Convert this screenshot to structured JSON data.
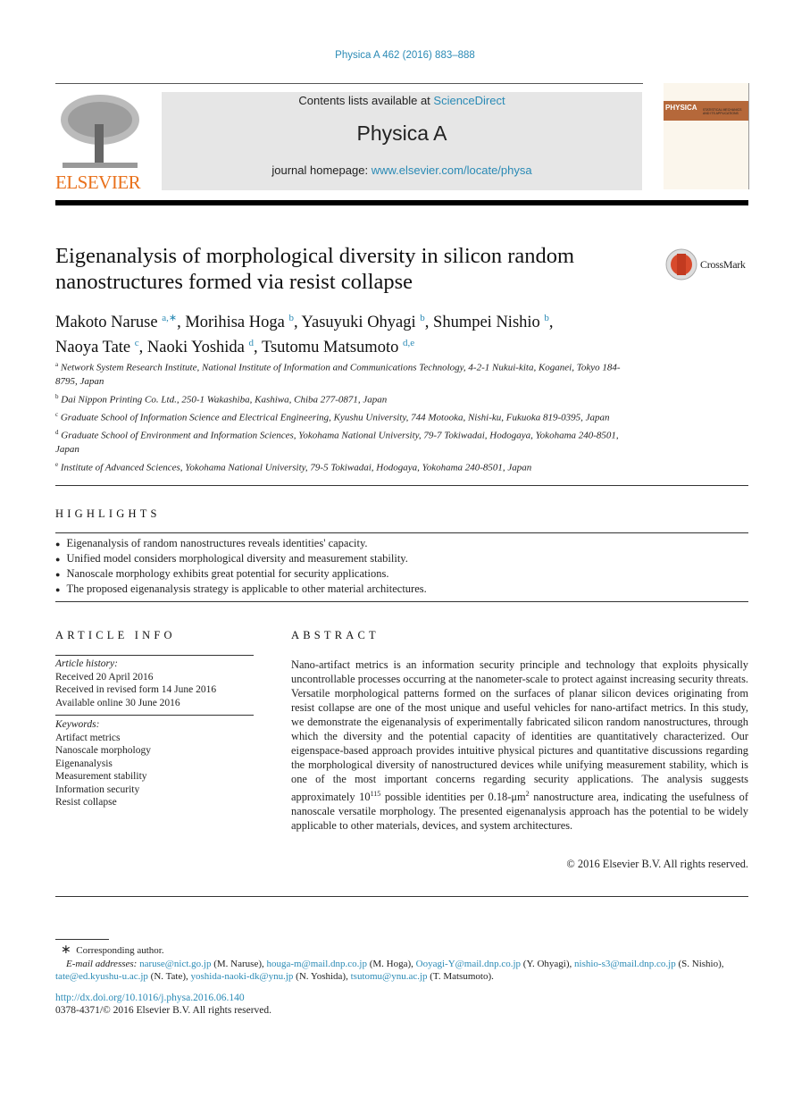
{
  "header": {
    "citation": "Physica A 462 (2016) 883–888",
    "contents_prefix": "Contents lists available at ",
    "contents_link": "ScienceDirect",
    "journal": "Physica A",
    "homepage_prefix": "journal homepage: ",
    "homepage_link": "www.elsevier.com/locate/physa",
    "publisher": "ELSEVIER",
    "cover_title": "PHYSICA",
    "cover_subtitle": "STATISTICAL MECHANICS AND ITS APPLICATIONS"
  },
  "title": {
    "line1": "Eigenanalysis of morphological diversity in silicon random",
    "line2": "nanostructures formed via resist collapse",
    "crossmark": "CrossMark"
  },
  "authors": [
    {
      "name": "Makoto Naruse",
      "sup": "a,∗",
      "sep": ", "
    },
    {
      "name": "Morihisa Hoga",
      "sup": "b",
      "sep": ", "
    },
    {
      "name": "Yasuyuki Ohyagi",
      "sup": "b",
      "sep": ", "
    },
    {
      "name": "Shumpei Nishio",
      "sup": "b",
      "sep": ","
    },
    {
      "name": "Naoya Tate",
      "sup": "c",
      "sep": ", "
    },
    {
      "name": "Naoki Yoshida",
      "sup": "d",
      "sep": ", "
    },
    {
      "name": "Tsutomu Matsumoto",
      "sup": "d,e",
      "sep": ""
    }
  ],
  "affiliations": [
    {
      "key": "a",
      "text": "Network System Research Institute, National Institute of Information and Communications Technology, 4-2-1 Nukui-kita, Koganei, Tokyo 184-8795, Japan"
    },
    {
      "key": "b",
      "text": "Dai Nippon Printing Co. Ltd., 250-1 Wakashiba, Kashiwa, Chiba 277-0871, Japan"
    },
    {
      "key": "c",
      "text": "Graduate School of Information Science and Electrical Engineering, Kyushu University, 744 Motooka, Nishi-ku, Fukuoka 819-0395, Japan"
    },
    {
      "key": "d",
      "text": "Graduate School of Environment and Information Sciences, Yokohama National University, 79-7 Tokiwadai, Hodogaya, Yokohama 240-8501, Japan"
    },
    {
      "key": "e",
      "text": "Institute of Advanced Sciences, Yokohama National University, 79-5 Tokiwadai, Hodogaya, Yokohama 240-8501, Japan"
    }
  ],
  "highlights": {
    "heading": "HIGHLIGHTS",
    "items": [
      "Eigenanalysis of random nanostructures reveals identities' capacity.",
      "Unified model considers morphological diversity and measurement stability.",
      "Nanoscale morphology exhibits great potential for security applications.",
      "The proposed eigenanalysis strategy is applicable to other material architectures."
    ]
  },
  "article_info": {
    "heading": "ARTICLE INFO",
    "history_label": "Article history:",
    "history": [
      "Received 20 April 2016",
      "Received in revised form 14 June 2016",
      "Available online 30 June 2016"
    ],
    "keywords_label": "Keywords:",
    "keywords": [
      "Artifact metrics",
      "Nanoscale morphology",
      "Eigenanalysis",
      "Measurement stability",
      "Information security",
      "Resist collapse"
    ]
  },
  "abstract": {
    "heading": "ABSTRACT",
    "text_before": "Nano-artifact metrics is an information security principle and technology that exploits physically uncontrollable processes occurring at the nanometer-scale to protect against increasing security threats. Versatile morphological patterns formed on the surfaces of planar silicon devices originating from resist collapse are one of the most unique and useful vehicles for nano-artifact metrics. In this study, we demonstrate the eigenanalysis of experimentally fabricated silicon random nanostructures, through which the diversity and the potential capacity of identities are quantitatively characterized. Our eigenspace-based approach provides intuitive physical pictures and quantitative discussions regarding the morphological diversity of nanostructured devices while unifying measurement stability, which is one of the most important concerns regarding security applications. The analysis suggests approximately 10",
    "exp1": "115",
    "text_mid": " possible identities per 0.18-μm",
    "exp2": "2",
    "text_after": " nanostructure area, indicating the usefulness of nanoscale versatile morphology. The presented eigenanalysis approach has the potential to be widely applicable to other materials, devices, and system architectures.",
    "copyright": "© 2016 Elsevier B.V. All rights reserved."
  },
  "footnotes": {
    "star": "∗",
    "corresponding": "Corresponding author.",
    "email_label": "E-mail addresses: ",
    "emails": [
      {
        "email": "naruse@nict.go.jp",
        "who": " (M. Naruse), "
      },
      {
        "email": "houga-m@mail.dnp.co.jp",
        "who": " (M. Hoga), "
      },
      {
        "email": "Ooyagi-Y@mail.dnp.co.jp",
        "who": " (Y. Ohyagi), "
      },
      {
        "email": "nishio-s3@mail.dnp.co.jp",
        "who": " (S. Nishio), "
      },
      {
        "email": "tate@ed.kyushu-u.ac.jp",
        "who": " (N. Tate), "
      },
      {
        "email": "yoshida-naoki-dk@ynu.jp",
        "who": " (N. Yoshida), "
      },
      {
        "email": "tsutomu@ynu.ac.jp",
        "who": " (T. Matsumoto)."
      }
    ],
    "doi": "http://dx.doi.org/10.1016/j.physa.2016.06.140",
    "issn": "0378-4371/© 2016 Elsevier B.V. All rights reserved."
  },
  "colors": {
    "link": "#2a8ab5",
    "elsevier_orange": "#e9711c",
    "header_box": "#e6e6e6"
  }
}
